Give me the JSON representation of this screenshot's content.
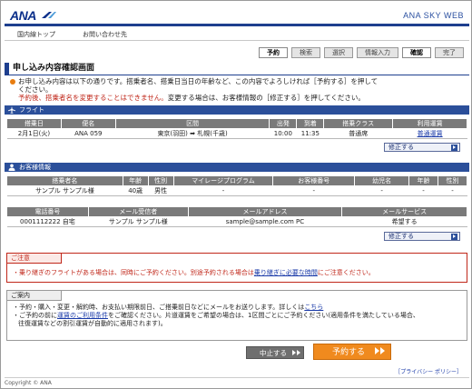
{
  "header": {
    "logo": "ANA",
    "brand": "ANA SKY WEB"
  },
  "nav": {
    "items": [
      "国内線トップ",
      "お問い合わせ先"
    ]
  },
  "steps": [
    "予約",
    "検索",
    "選択",
    "情報入力",
    "確認",
    "完了"
  ],
  "active_steps": [
    "予約",
    "確認"
  ],
  "page_title": "申し込み内容確認画面",
  "intro": {
    "line1": "お申し込み内容は以下の通りです。搭乗者名、搭乗日当日の年齢など、この内容でよろしければ［予約する］を押して",
    "line2": "ください。",
    "warning_red": "予約後、搭乗者名を変更することはできません。",
    "warning_rest": "変更する場合は、お客様情報の［修正する］を押してください。"
  },
  "flight": {
    "section_title": "フライト",
    "headers": [
      "搭乗日",
      "便名",
      "区間",
      "出発",
      "到着",
      "搭乗クラス",
      "利用運賃"
    ],
    "row": [
      "2月1日(火)",
      "ANA 059",
      "東京(羽田) ➡ 札幌(千歳)",
      "10:00",
      "11:35",
      "普通席",
      "普通運賃"
    ],
    "fix_label": "修正する"
  },
  "customer": {
    "section_title": "お客様情報",
    "headers": [
      "搭乗者名",
      "年齢",
      "性別",
      "マイレージプログラム",
      "お客様番号",
      "幼児名",
      "年齢",
      "性別"
    ],
    "row": [
      "サンプル サンプル様",
      "40歳",
      "男性",
      "-",
      "-",
      "-",
      "-",
      "-"
    ],
    "headers2": [
      "電話番号",
      "メール受信者",
      "メールアドレス",
      "メールサービス"
    ],
    "row2": [
      "0001112222 自宅",
      "サンプル サンプル様",
      "sample@sample.com PC",
      "希望する"
    ],
    "fix_label": "修正する"
  },
  "notice": {
    "title": "ご注意",
    "text_before": "・乗り継ぎのフライトがある場合は、同時にご予約ください。別途予約される場合は",
    "link": "乗り継ぎに必要な時間",
    "text_after": "にご注意ください。"
  },
  "guide": {
    "title": "ご案内",
    "line1_before": "・予約・購入・変更・解約時、お支払い期限前日、ご搭乗前日などにメールをお送りします。詳しくは",
    "line1_link": "こちら",
    "line2_before": "・ご予約の前に",
    "line2_link": "運賃のご利用条件",
    "line2_after": "をご確認ください。片道運賃をご希望の場合は、1区間ごとにご予約ください(適用条件を満たしている場合、",
    "line3": "往復運賃などの割引運賃が自動的に適用されます)。"
  },
  "buttons": {
    "cancel": "中止する",
    "submit": "予約する"
  },
  "privacy": "［プライバシー ポリシー］",
  "footer": "Copyright © ANA",
  "colors": {
    "brand_navy": "#1e3f8f",
    "section_blue": "#2b4f9a",
    "submit_orange": "#f08a1e",
    "warning_red": "#c0271a"
  }
}
